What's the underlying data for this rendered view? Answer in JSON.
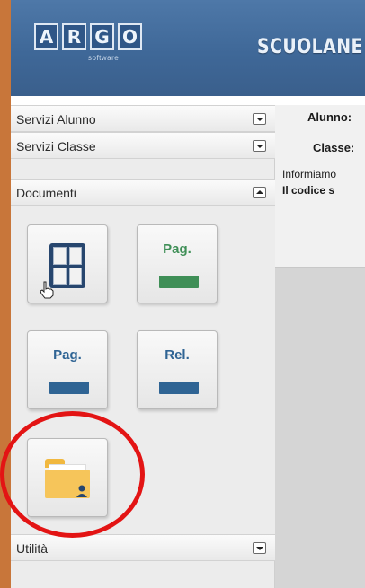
{
  "header": {
    "logo_letters": [
      "A",
      "R",
      "G",
      "O"
    ],
    "logo_sub": "software",
    "brand": "SCUOLANE"
  },
  "sidebar": {
    "sections": [
      {
        "label": "Servizi Alunno",
        "state": "collapsed"
      },
      {
        "label": "Servizi Classe",
        "state": "collapsed"
      },
      {
        "label": "Documenti",
        "state": "expanded"
      },
      {
        "label": "Utilità",
        "state": "collapsed"
      }
    ],
    "documents_tiles": [
      {
        "icon": "grid-icon"
      },
      {
        "icon": "page-icon",
        "text": "Pag.",
        "bar_color": "#3f8f57"
      },
      {
        "icon": "page-icon",
        "text": "Pag.",
        "bar_color": "#2f6494"
      },
      {
        "icon": "report-icon",
        "text": "Rel.",
        "bar_color": "#2f6494"
      },
      {
        "icon": "folder-user-icon"
      }
    ]
  },
  "main": {
    "alunno_label": "Alunno:",
    "classe_label": "Classe:",
    "info_text": "Informiamo",
    "codice_text": "Il codice s"
  },
  "colors": {
    "header": "#3f6898",
    "accent_strip": "#c8763a",
    "highlight_circle": "#e31414",
    "pag_text_green": "#3f8f57",
    "pag_text_blue": "#2f6494"
  }
}
